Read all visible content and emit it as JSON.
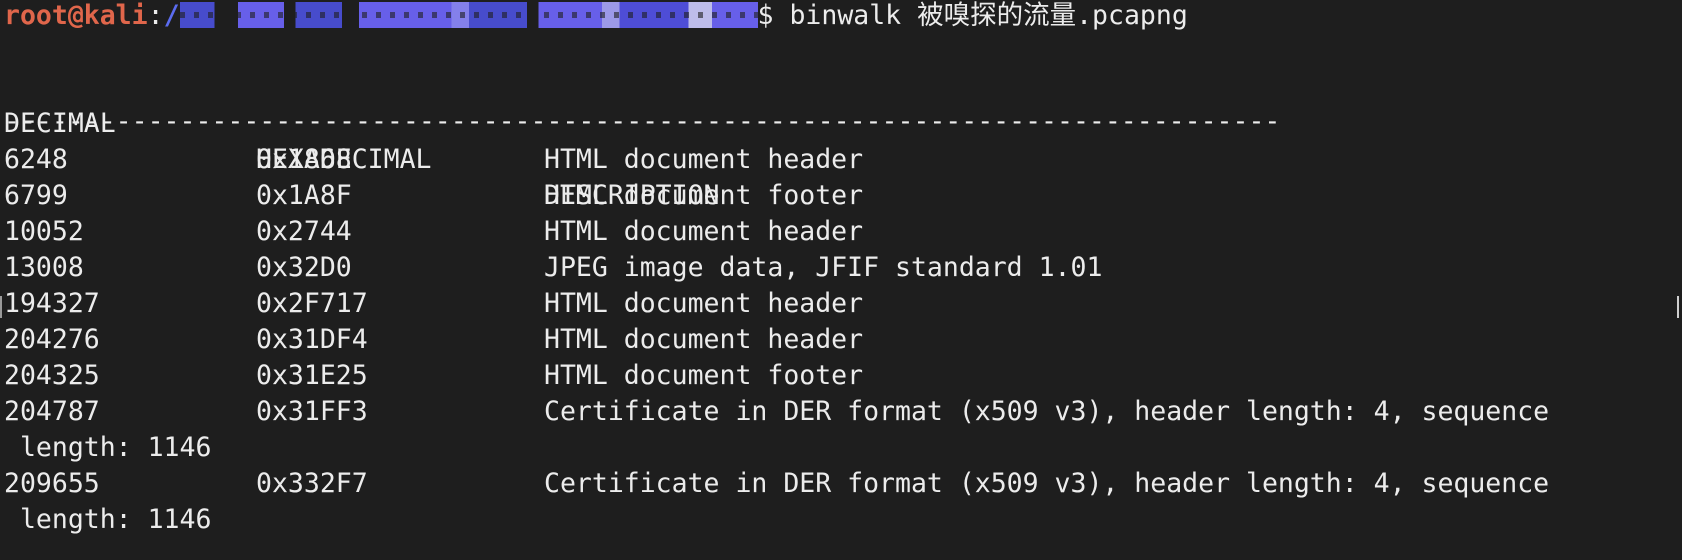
{
  "terminal": {
    "prompt": {
      "user_host": "root@kali",
      "colon": ":",
      "path_prefix": "/",
      "path_redacted_tail": "$ ",
      "command": "binwalk 被嗅探的流量.pcapng"
    },
    "headers": {
      "decimal": "DECIMAL",
      "hexadecimal": "HEXADECIMAL",
      "description": "DESCRIPTION"
    },
    "separator": "--------------------------------------------------------------------------------",
    "rows": [
      {
        "decimal": "6248",
        "hex": "0x1868",
        "description": "HTML document header"
      },
      {
        "decimal": "6799",
        "hex": "0x1A8F",
        "description": "HTML document footer"
      },
      {
        "decimal": "10052",
        "hex": "0x2744",
        "description": "HTML document header"
      },
      {
        "decimal": "13008",
        "hex": "0x32D0",
        "description": "JPEG image data, JFIF standard 1.01"
      },
      {
        "decimal": "194327",
        "hex": "0x2F717",
        "description": "HTML document header"
      },
      {
        "decimal": "204276",
        "hex": "0x31DF4",
        "description": "HTML document header"
      },
      {
        "decimal": "204325",
        "hex": "0x31E25",
        "description": "HTML document footer"
      },
      {
        "decimal": "204787",
        "hex": "0x31FF3",
        "description": "Certificate in DER format (x509 v3), header length: 4, sequence",
        "wrap": " length: 1146"
      },
      {
        "decimal": "209655",
        "hex": "0x332F7",
        "description": "Certificate in DER format (x509 v3), header length: 4, sequence",
        "wrap": " length: 1146"
      }
    ],
    "colors": {
      "background": "#1e1e1e",
      "foreground": "#ececec",
      "user_host": "#e0664b",
      "path": "#5b6cf0"
    }
  }
}
